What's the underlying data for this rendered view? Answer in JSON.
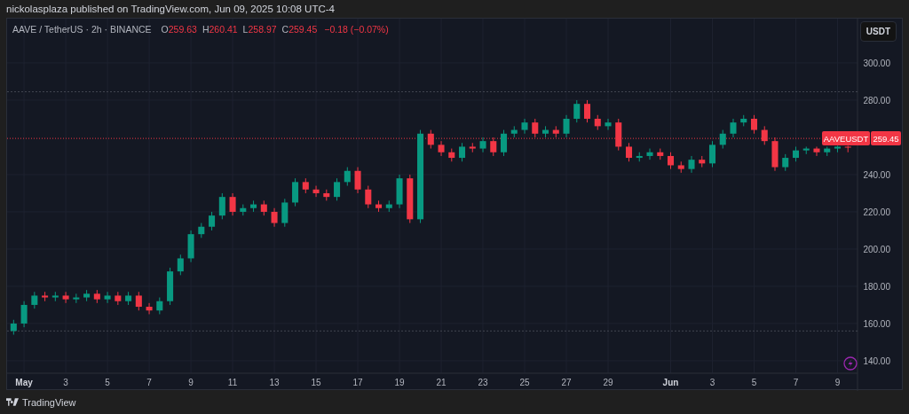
{
  "header": {
    "text": "nickolasplaza published on TradingView.com, Jun 09, 2025 10:08 UTC-4"
  },
  "legend": {
    "symbol": "AAVE / TetherUS · 2h · BINANCE",
    "ohlc": [
      {
        "key": "O",
        "value": "259.63"
      },
      {
        "key": "H",
        "value": "260.41"
      },
      {
        "key": "L",
        "value": "258.97"
      },
      {
        "key": "C",
        "value": "259.45"
      }
    ],
    "change": "−0.18 (−0.07%)"
  },
  "currency_button": "USDT",
  "chart_data": {
    "type": "candlestick",
    "grid": true,
    "xlim": [
      "2025-04-30T04:30",
      "2025-06-09T23:00"
    ],
    "ylim": [
      133.3,
      323.8
    ],
    "yticks": [
      {
        "value": 140,
        "label": "140.00"
      },
      {
        "value": 160,
        "label": "160.00"
      },
      {
        "value": 180,
        "label": "180.00"
      },
      {
        "value": 200,
        "label": "200.00"
      },
      {
        "value": 220,
        "label": "220.00"
      },
      {
        "value": 240,
        "label": "240.00"
      },
      {
        "value": 280,
        "label": "280.00"
      },
      {
        "value": 300,
        "label": "300.00"
      }
    ],
    "xticks": [
      {
        "value": "2025-05-01T00:00",
        "label": "May"
      },
      {
        "value": "2025-05-03T00:00",
        "label": "3"
      },
      {
        "value": "2025-05-05T00:00",
        "label": "5"
      },
      {
        "value": "2025-05-07T00:00",
        "label": "7"
      },
      {
        "value": "2025-05-09T00:00",
        "label": "9"
      },
      {
        "value": "2025-05-11T00:00",
        "label": "11"
      },
      {
        "value": "2025-05-13T00:00",
        "label": "13"
      },
      {
        "value": "2025-05-15T00:00",
        "label": "15"
      },
      {
        "value": "2025-05-17T00:00",
        "label": "17"
      },
      {
        "value": "2025-05-19T00:00",
        "label": "19"
      },
      {
        "value": "2025-05-21T00:00",
        "label": "21"
      },
      {
        "value": "2025-05-23T00:00",
        "label": "23"
      },
      {
        "value": "2025-05-25T00:00",
        "label": "25"
      },
      {
        "value": "2025-05-27T00:00",
        "label": "27"
      },
      {
        "value": "2025-05-29T00:00",
        "label": "29"
      },
      {
        "value": "2025-06-01T00:00",
        "label": "Jun"
      },
      {
        "value": "2025-06-03T00:00",
        "label": "3"
      },
      {
        "value": "2025-06-05T00:00",
        "label": "5"
      },
      {
        "value": "2025-06-07T00:00",
        "label": "7"
      },
      {
        "value": "2025-06-09T00:00",
        "label": "9"
      }
    ],
    "x": [
      "2025-04-30T12:00",
      "2025-05-01T00:00",
      "2025-05-01T12:00",
      "2025-05-02T00:00",
      "2025-05-02T12:00",
      "2025-05-03T00:00",
      "2025-05-03T12:00",
      "2025-05-04T00:00",
      "2025-05-04T12:00",
      "2025-05-05T00:00",
      "2025-05-05T12:00",
      "2025-05-06T00:00",
      "2025-05-06T12:00",
      "2025-05-07T00:00",
      "2025-05-07T12:00",
      "2025-05-08T00:00",
      "2025-05-08T12:00",
      "2025-05-09T00:00",
      "2025-05-09T12:00",
      "2025-05-10T00:00",
      "2025-05-10T12:00",
      "2025-05-11T00:00",
      "2025-05-11T12:00",
      "2025-05-12T00:00",
      "2025-05-12T12:00",
      "2025-05-13T00:00",
      "2025-05-13T12:00",
      "2025-05-14T00:00",
      "2025-05-14T12:00",
      "2025-05-15T00:00",
      "2025-05-15T12:00",
      "2025-05-16T00:00",
      "2025-05-16T12:00",
      "2025-05-17T00:00",
      "2025-05-17T12:00",
      "2025-05-18T00:00",
      "2025-05-18T12:00",
      "2025-05-19T00:00",
      "2025-05-19T12:00",
      "2025-05-20T00:00",
      "2025-05-20T12:00",
      "2025-05-21T00:00",
      "2025-05-21T12:00",
      "2025-05-22T00:00",
      "2025-05-22T12:00",
      "2025-05-23T00:00",
      "2025-05-23T12:00",
      "2025-05-24T00:00",
      "2025-05-24T12:00",
      "2025-05-25T00:00",
      "2025-05-25T12:00",
      "2025-05-26T00:00",
      "2025-05-26T12:00",
      "2025-05-27T00:00",
      "2025-05-27T12:00",
      "2025-05-28T00:00",
      "2025-05-28T12:00",
      "2025-05-29T00:00",
      "2025-05-29T12:00",
      "2025-05-30T00:00",
      "2025-05-30T12:00",
      "2025-05-31T00:00",
      "2025-05-31T12:00",
      "2025-06-01T00:00",
      "2025-06-01T12:00",
      "2025-06-02T00:00",
      "2025-06-02T12:00",
      "2025-06-03T00:00",
      "2025-06-03T12:00",
      "2025-06-04T00:00",
      "2025-06-04T12:00",
      "2025-06-05T00:00",
      "2025-06-05T12:00",
      "2025-06-06T00:00",
      "2025-06-06T12:00",
      "2025-06-07T00:00",
      "2025-06-07T12:00",
      "2025-06-08T00:00",
      "2025-06-08T12:00",
      "2025-06-09T00:00",
      "2025-06-09T12:00"
    ],
    "ohlc": [
      [
        156,
        162,
        154,
        160
      ],
      [
        160,
        172,
        158,
        170
      ],
      [
        170,
        177,
        168,
        175
      ],
      [
        175,
        177,
        172,
        174
      ],
      [
        174,
        177,
        172,
        175
      ],
      [
        175,
        177,
        171,
        173
      ],
      [
        173,
        176,
        171,
        174
      ],
      [
        174,
        178,
        172,
        176
      ],
      [
        176,
        178,
        171,
        173
      ],
      [
        173,
        177,
        171,
        175
      ],
      [
        175,
        177,
        170,
        172
      ],
      [
        172,
        177,
        170,
        175
      ],
      [
        175,
        177,
        167,
        169
      ],
      [
        169,
        171,
        165,
        167
      ],
      [
        167,
        174,
        165,
        172
      ],
      [
        172,
        190,
        170,
        188
      ],
      [
        188,
        197,
        186,
        195
      ],
      [
        195,
        210,
        193,
        208
      ],
      [
        208,
        214,
        206,
        212
      ],
      [
        212,
        220,
        210,
        218
      ],
      [
        218,
        230,
        216,
        228
      ],
      [
        228,
        230,
        218,
        220
      ],
      [
        220,
        224,
        218,
        222
      ],
      [
        222,
        226,
        220,
        224
      ],
      [
        224,
        226,
        218,
        220
      ],
      [
        220,
        222,
        212,
        214
      ],
      [
        214,
        227,
        212,
        225
      ],
      [
        225,
        238,
        223,
        236
      ],
      [
        236,
        238,
        230,
        232
      ],
      [
        232,
        234,
        228,
        230
      ],
      [
        230,
        232,
        226,
        228
      ],
      [
        228,
        238,
        226,
        236
      ],
      [
        236,
        244,
        234,
        242
      ],
      [
        242,
        244,
        230,
        232
      ],
      [
        232,
        234,
        222,
        224
      ],
      [
        224,
        226,
        220,
        222
      ],
      [
        222,
        226,
        220,
        224
      ],
      [
        224,
        240,
        222,
        238
      ],
      [
        238,
        240,
        214,
        216
      ],
      [
        216,
        264,
        214,
        262
      ],
      [
        262,
        264,
        254,
        256
      ],
      [
        256,
        258,
        250,
        252
      ],
      [
        252,
        254,
        247,
        249
      ],
      [
        249,
        257,
        247,
        255
      ],
      [
        255,
        257,
        252,
        254
      ],
      [
        254,
        260,
        252,
        258
      ],
      [
        258,
        260,
        250,
        252
      ],
      [
        252,
        264,
        250,
        262
      ],
      [
        262,
        266,
        260,
        264
      ],
      [
        264,
        270,
        262,
        268
      ],
      [
        268,
        270,
        260,
        262
      ],
      [
        262,
        266,
        260,
        264
      ],
      [
        264,
        266,
        260,
        262
      ],
      [
        262,
        272,
        260,
        270
      ],
      [
        270,
        280,
        268,
        278
      ],
      [
        278,
        280,
        268,
        270
      ],
      [
        270,
        272,
        264,
        266
      ],
      [
        266,
        270,
        264,
        268
      ],
      [
        268,
        270,
        253,
        255
      ],
      [
        255,
        257,
        247,
        249
      ],
      [
        249,
        252,
        247,
        250
      ],
      [
        250,
        254,
        248,
        252
      ],
      [
        252,
        254,
        248,
        250
      ],
      [
        250,
        252,
        243,
        245
      ],
      [
        245,
        247,
        241,
        243
      ],
      [
        243,
        250,
        241,
        248
      ],
      [
        248,
        250,
        244,
        246
      ],
      [
        246,
        258,
        244,
        256
      ],
      [
        256,
        264,
        254,
        262
      ],
      [
        262,
        270,
        260,
        268
      ],
      [
        268,
        272,
        266,
        270
      ],
      [
        270,
        272,
        262,
        264
      ],
      [
        264,
        266,
        256,
        258
      ],
      [
        258,
        260,
        242,
        244
      ],
      [
        244,
        251,
        242,
        249
      ],
      [
        249,
        255,
        247,
        253
      ],
      [
        253,
        255,
        251,
        254
      ],
      [
        254,
        255,
        250,
        252
      ],
      [
        252,
        255,
        250,
        254
      ],
      [
        254,
        255.5,
        252,
        255
      ],
      [
        255,
        255.5,
        252,
        254.5
      ]
    ],
    "ref_lines": [
      {
        "axis": "y",
        "value": 284.5
      },
      {
        "axis": "y",
        "value": 156
      },
      {
        "axis": "y",
        "value": 259.45,
        "color": "#f23645"
      }
    ],
    "annotations": [
      "AAVEUSDT",
      "259.45"
    ]
  },
  "footer": {
    "brand": "TradingView"
  }
}
